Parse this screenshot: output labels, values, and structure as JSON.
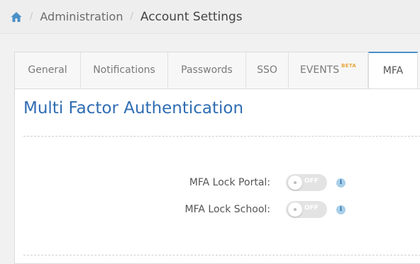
{
  "breadcrumb": {
    "home_icon": "home-icon",
    "items": [
      "Administration",
      "Account Settings"
    ]
  },
  "tabs": [
    {
      "label": "General",
      "active": false
    },
    {
      "label": "Notifications",
      "active": false
    },
    {
      "label": "Passwords",
      "active": false
    },
    {
      "label": "SSO",
      "active": false
    },
    {
      "label": "EVENTS",
      "badge": "BETA",
      "active": false
    },
    {
      "label": "MFA",
      "active": true
    }
  ],
  "section": {
    "title": "Multi Factor Authentication",
    "settings": [
      {
        "label": "MFA Lock Portal:",
        "state": "OFF",
        "info_icon": "info-icon"
      },
      {
        "label": "MFA Lock School:",
        "state": "OFF",
        "info_icon": "info-icon"
      }
    ]
  },
  "colors": {
    "accent": "#2f6db3",
    "tab_active_border": "#4a90c8",
    "beta_badge": "#e8a53a",
    "info_icon": "#a9cfe9"
  }
}
